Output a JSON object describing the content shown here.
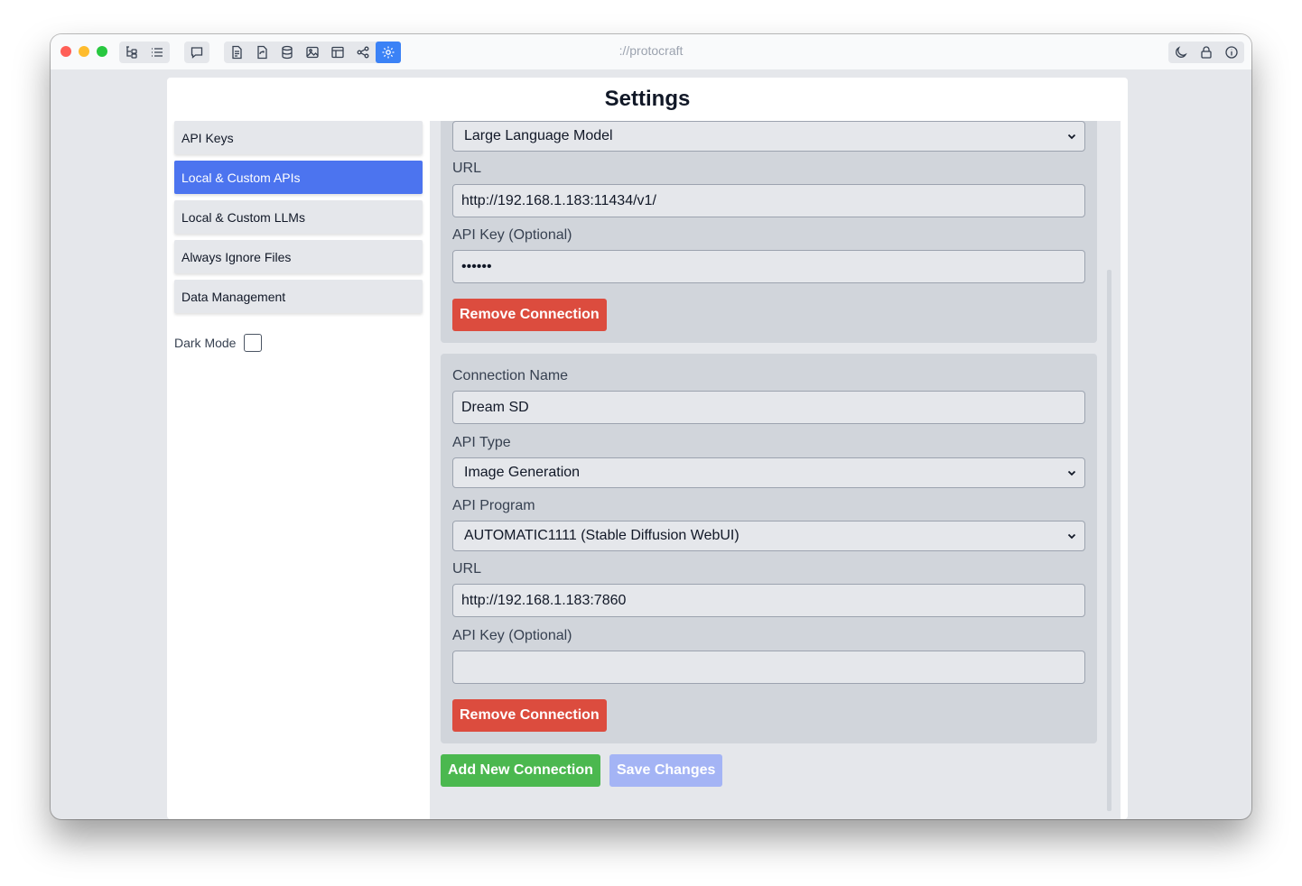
{
  "window": {
    "title": "://protocraft",
    "colors": {
      "accent": "#3b82f6",
      "remove": "#dc4c3e",
      "add": "#4bb84f",
      "save_disabled": "#a4b4f5"
    }
  },
  "toolbar": {
    "left_icons": [
      "tree-icon",
      "list-icon"
    ],
    "chat_icon": "chat-icon",
    "tool_icons": [
      "file-text-icon",
      "file-sync-icon",
      "database-icon",
      "image-icon",
      "layout-icon",
      "workflow-icon",
      "gear-icon"
    ],
    "right_icons": [
      "moon-icon",
      "lock-icon",
      "info-icon"
    ]
  },
  "page": {
    "title": "Settings"
  },
  "sidebar": {
    "items": [
      {
        "label": "API Keys",
        "active": false
      },
      {
        "label": "Local & Custom APIs",
        "active": true
      },
      {
        "label": "Local & Custom LLMs",
        "active": false
      },
      {
        "label": "Always Ignore Files",
        "active": false
      },
      {
        "label": "Data Management",
        "active": false
      }
    ],
    "dark_mode": {
      "label": "Dark Mode",
      "checked": false
    }
  },
  "connections": [
    {
      "api_type": "Large Language Model",
      "url_label": "URL",
      "url": "http://192.168.1.183:11434/v1/",
      "api_key_label": "API Key (Optional)",
      "api_key": "••••••",
      "remove_label": "Remove Connection"
    },
    {
      "name_label": "Connection Name",
      "name": "Dream SD",
      "api_type_label": "API Type",
      "api_type": "Image Generation",
      "api_program_label": "API Program",
      "api_program": "AUTOMATIC1111 (Stable Diffusion WebUI)",
      "url_label": "URL",
      "url": "http://192.168.1.183:7860",
      "api_key_label": "API Key (Optional)",
      "api_key": "",
      "remove_label": "Remove Connection"
    }
  ],
  "actions": {
    "add_label": "Add New Connection",
    "save_label": "Save Changes"
  }
}
